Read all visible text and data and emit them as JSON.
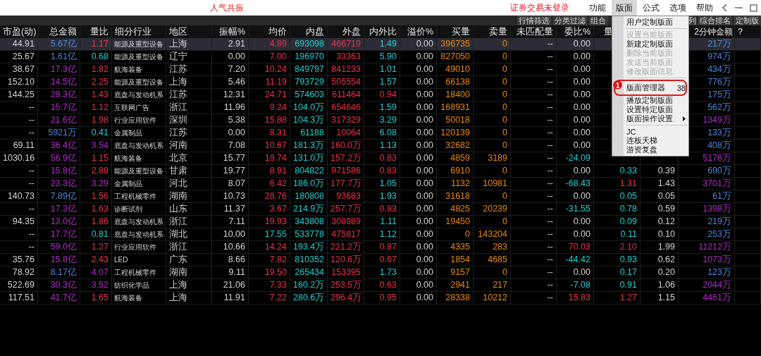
{
  "window": {
    "title": "人气共振",
    "login_status": "证券交易未登录"
  },
  "menus": [
    {
      "label": "功能",
      "selected": false
    },
    {
      "label": "版面",
      "selected": true
    },
    {
      "label": "公式",
      "selected": false
    },
    {
      "label": "选项",
      "selected": false
    },
    {
      "label": "帮助",
      "selected": false
    }
  ],
  "toolbar": [
    {
      "label": "行情筛选"
    },
    {
      "label": "分类过滤"
    },
    {
      "label": "组合"
    },
    {
      "label": "列"
    },
    {
      "label": "综合排名"
    },
    {
      "label": "定制版"
    }
  ],
  "table": {
    "columns": [
      {
        "label": "市盈(动)"
      },
      {
        "label": "总金额"
      },
      {
        "label": "量比"
      },
      {
        "label": "细分行业"
      },
      {
        "label": "地区"
      },
      {
        "label": "振幅%"
      },
      {
        "label": "均价"
      },
      {
        "label": "内盘"
      },
      {
        "label": "外盘"
      },
      {
        "label": "内外比"
      },
      {
        "label": "溢价%"
      },
      {
        "label": "买量"
      },
      {
        "label": "卖量"
      },
      {
        "label": "未匹配量"
      },
      {
        "label": "委比%"
      },
      {
        "label": "量"
      },
      null,
      {
        "label": "2分钟金额"
      },
      {
        "label": "?"
      }
    ],
    "rows": [
      {
        "selected": true,
        "cells": [
          {
            "text": "44.91",
            "kind": "plain"
          },
          {
            "text": "5.67亿",
            "kind": "tier1"
          },
          {
            "text": "1.17",
            "kind": "up"
          },
          {
            "text": "能源及重型设备",
            "kind": "plain"
          },
          {
            "text": "上海",
            "kind": "plain"
          },
          {
            "text": "2.91",
            "kind": "plain"
          },
          {
            "text": "4.89",
            "kind": "up"
          },
          {
            "text": "693098",
            "kind": "down"
          },
          {
            "text": "466719",
            "kind": "up"
          },
          {
            "text": "1.49",
            "kind": "down"
          },
          {
            "text": "0.00",
            "kind": "plain"
          },
          {
            "text": "396735",
            "kind": "volume"
          },
          {
            "text": "0",
            "kind": "volume"
          },
          {
            "text": "--",
            "kind": "plain"
          },
          {
            "text": "0.00",
            "kind": "plain"
          },
          null,
          null,
          {
            "text": "217万",
            "kind": "tier1"
          }
        ]
      },
      {
        "selected": false,
        "cells": [
          {
            "text": "25.67",
            "kind": "plain"
          },
          {
            "text": "1.61亿",
            "kind": "tier1"
          },
          {
            "text": "0.68",
            "kind": "down"
          },
          {
            "text": "能源及重型设备",
            "kind": "plain"
          },
          {
            "text": "辽宁",
            "kind": "plain"
          },
          {
            "text": "0.00",
            "kind": "plain"
          },
          {
            "text": "7.00",
            "kind": "up"
          },
          {
            "text": "196970",
            "kind": "down"
          },
          {
            "text": "33363",
            "kind": "up"
          },
          {
            "text": "5.90",
            "kind": "down"
          },
          {
            "text": "0.00",
            "kind": "plain"
          },
          {
            "text": "827050",
            "kind": "volume"
          },
          {
            "text": "0",
            "kind": "volume"
          },
          {
            "text": "--",
            "kind": "plain"
          },
          {
            "text": "0.00",
            "kind": "plain"
          },
          null,
          null,
          {
            "text": "974万",
            "kind": "tier1"
          }
        ]
      },
      {
        "selected": false,
        "cells": [
          {
            "text": "38.67",
            "kind": "plain"
          },
          {
            "text": "17.3亿",
            "kind": "tier2"
          },
          {
            "text": "1.82",
            "kind": "up"
          },
          {
            "text": "航海装备",
            "kind": "plain"
          },
          {
            "text": "江苏",
            "kind": "plain"
          },
          {
            "text": "7.20",
            "kind": "plain"
          },
          {
            "text": "10.24",
            "kind": "up"
          },
          {
            "text": "849797",
            "kind": "down"
          },
          {
            "text": "841233",
            "kind": "up"
          },
          {
            "text": "1.01",
            "kind": "down"
          },
          {
            "text": "0.00",
            "kind": "plain"
          },
          {
            "text": "49010",
            "kind": "volume"
          },
          {
            "text": "0",
            "kind": "volume"
          },
          {
            "text": "--",
            "kind": "plain"
          },
          {
            "text": "0.00",
            "kind": "plain"
          },
          null,
          null,
          {
            "text": "434万",
            "kind": "tier1"
          }
        ]
      },
      {
        "selected": false,
        "cells": [
          {
            "text": "152.10",
            "kind": "plain"
          },
          {
            "text": "14.5亿",
            "kind": "tier2"
          },
          {
            "text": "2.25",
            "kind": "up"
          },
          {
            "text": "能源及重型设备",
            "kind": "plain"
          },
          {
            "text": "上海",
            "kind": "plain"
          },
          {
            "text": "5.46",
            "kind": "plain"
          },
          {
            "text": "11.19",
            "kind": "up"
          },
          {
            "text": "793729",
            "kind": "down"
          },
          {
            "text": "505554",
            "kind": "up"
          },
          {
            "text": "1.57",
            "kind": "down"
          },
          {
            "text": "0.00",
            "kind": "plain"
          },
          {
            "text": "66138",
            "kind": "volume"
          },
          {
            "text": "0",
            "kind": "volume"
          },
          {
            "text": "--",
            "kind": "plain"
          },
          {
            "text": "0.00",
            "kind": "plain"
          },
          null,
          null,
          {
            "text": "776万",
            "kind": "tier1"
          }
        ]
      },
      {
        "selected": false,
        "cells": [
          {
            "text": "144.25",
            "kind": "plain"
          },
          {
            "text": "29.3亿",
            "kind": "tier2"
          },
          {
            "text": "1.43",
            "kind": "up"
          },
          {
            "text": "底盘与发动机系",
            "kind": "plain"
          },
          {
            "text": "江苏",
            "kind": "plain"
          },
          {
            "text": "12.31",
            "kind": "plain"
          },
          {
            "text": "24.71",
            "kind": "up"
          },
          {
            "text": "574603",
            "kind": "down"
          },
          {
            "text": "611464",
            "kind": "up"
          },
          {
            "text": "0.94",
            "kind": "up"
          },
          {
            "text": "0.00",
            "kind": "plain"
          },
          {
            "text": "18400",
            "kind": "volume"
          },
          {
            "text": "0",
            "kind": "volume"
          },
          {
            "text": "--",
            "kind": "plain"
          },
          {
            "text": "0.00",
            "kind": "plain"
          },
          null,
          null,
          {
            "text": "175万",
            "kind": "tier1"
          }
        ]
      },
      {
        "selected": false,
        "cells": [
          {
            "text": "--",
            "kind": "plain"
          },
          {
            "text": "15.7亿",
            "kind": "tier2"
          },
          {
            "text": "1.12",
            "kind": "up"
          },
          {
            "text": "互联网广告",
            "kind": "plain"
          },
          {
            "text": "浙江",
            "kind": "plain"
          },
          {
            "text": "11.96",
            "kind": "plain"
          },
          {
            "text": "9.24",
            "kind": "up"
          },
          {
            "text": "104.0万",
            "kind": "down"
          },
          {
            "text": "654646",
            "kind": "up"
          },
          {
            "text": "1.59",
            "kind": "down"
          },
          {
            "text": "0.00",
            "kind": "plain"
          },
          {
            "text": "168931",
            "kind": "volume"
          },
          {
            "text": "0",
            "kind": "volume"
          },
          {
            "text": "--",
            "kind": "plain"
          },
          {
            "text": "0.00",
            "kind": "plain"
          },
          null,
          null,
          {
            "text": "562万",
            "kind": "tier1"
          }
        ]
      },
      {
        "selected": false,
        "cells": [
          {
            "text": "--",
            "kind": "plain"
          },
          {
            "text": "21.6亿",
            "kind": "tier2"
          },
          {
            "text": "1.98",
            "kind": "up"
          },
          {
            "text": "行业应用软件",
            "kind": "plain"
          },
          {
            "text": "深圳",
            "kind": "plain"
          },
          {
            "text": "5.38",
            "kind": "plain"
          },
          {
            "text": "15.88",
            "kind": "up"
          },
          {
            "text": "104.3万",
            "kind": "down"
          },
          {
            "text": "317329",
            "kind": "up"
          },
          {
            "text": "3.29",
            "kind": "down"
          },
          {
            "text": "0.00",
            "kind": "plain"
          },
          {
            "text": "50018",
            "kind": "volume"
          },
          {
            "text": "0",
            "kind": "volume"
          },
          {
            "text": "--",
            "kind": "plain"
          },
          {
            "text": "0.00",
            "kind": "plain"
          },
          null,
          null,
          {
            "text": "1349万",
            "kind": "tier2"
          }
        ]
      },
      {
        "selected": false,
        "cells": [
          {
            "text": "--",
            "kind": "plain"
          },
          {
            "text": "5921万",
            "kind": "tier1"
          },
          {
            "text": "0.41",
            "kind": "down"
          },
          {
            "text": "金属制品",
            "kind": "plain"
          },
          {
            "text": "江苏",
            "kind": "plain"
          },
          {
            "text": "0.00",
            "kind": "plain"
          },
          {
            "text": "8.31",
            "kind": "up"
          },
          {
            "text": "61188",
            "kind": "down"
          },
          {
            "text": "10064",
            "kind": "up"
          },
          {
            "text": "6.08",
            "kind": "down"
          },
          {
            "text": "0.00",
            "kind": "plain"
          },
          {
            "text": "120139",
            "kind": "volume"
          },
          {
            "text": "0",
            "kind": "volume"
          },
          {
            "text": "--",
            "kind": "plain"
          },
          {
            "text": "0.00",
            "kind": "plain"
          },
          null,
          null,
          {
            "text": "133万",
            "kind": "tier1"
          }
        ]
      },
      {
        "selected": false,
        "cells": [
          {
            "text": "69.11",
            "kind": "plain"
          },
          {
            "text": "36.4亿",
            "kind": "tier2"
          },
          {
            "text": "3.54",
            "kind": "tier2"
          },
          {
            "text": "底盘与发动机系",
            "kind": "plain"
          },
          {
            "text": "河南",
            "kind": "plain"
          },
          {
            "text": "7.08",
            "kind": "plain"
          },
          {
            "text": "10.67",
            "kind": "up"
          },
          {
            "text": "181.3万",
            "kind": "down"
          },
          {
            "text": "160.0万",
            "kind": "up"
          },
          {
            "text": "1.13",
            "kind": "down"
          },
          {
            "text": "0.00",
            "kind": "plain"
          },
          {
            "text": "32682",
            "kind": "volume"
          },
          {
            "text": "0",
            "kind": "volume"
          },
          {
            "text": "--",
            "kind": "plain"
          },
          {
            "text": "0.00",
            "kind": "plain"
          },
          null,
          null,
          {
            "text": "408万",
            "kind": "tier1"
          }
        ]
      },
      {
        "selected": false,
        "cells": [
          {
            "text": "1030.16",
            "kind": "plain"
          },
          {
            "text": "56.9亿",
            "kind": "tier2"
          },
          {
            "text": "1.15",
            "kind": "up"
          },
          {
            "text": "航海装备",
            "kind": "plain"
          },
          {
            "text": "北京",
            "kind": "plain"
          },
          {
            "text": "15.77",
            "kind": "plain"
          },
          {
            "text": "19.74",
            "kind": "up"
          },
          {
            "text": "131.0万",
            "kind": "down"
          },
          {
            "text": "157.2万",
            "kind": "up"
          },
          {
            "text": "0.83",
            "kind": "up"
          },
          {
            "text": "0.00",
            "kind": "plain"
          },
          {
            "text": "4859",
            "kind": "volume"
          },
          {
            "text": "3189",
            "kind": "volume"
          },
          {
            "text": "--",
            "kind": "plain"
          },
          {
            "text": "-24.09",
            "kind": "down"
          },
          null,
          null,
          {
            "text": "5176万",
            "kind": "tier2"
          }
        ]
      },
      {
        "selected": false,
        "cells": [
          {
            "text": "--",
            "kind": "plain"
          },
          {
            "text": "15.8亿",
            "kind": "tier2"
          },
          {
            "text": "2.88",
            "kind": "up"
          },
          {
            "text": "能源及重型设备",
            "kind": "plain"
          },
          {
            "text": "甘肃",
            "kind": "plain"
          },
          {
            "text": "19.77",
            "kind": "plain"
          },
          {
            "text": "8.91",
            "kind": "up"
          },
          {
            "text": "804822",
            "kind": "down"
          },
          {
            "text": "971586",
            "kind": "up"
          },
          {
            "text": "0.83",
            "kind": "up"
          },
          {
            "text": "0.00",
            "kind": "plain"
          },
          {
            "text": "6910",
            "kind": "volume"
          },
          {
            "text": "0",
            "kind": "volume"
          },
          {
            "text": "--",
            "kind": "plain"
          },
          {
            "text": "0.00",
            "kind": "plain"
          },
          {
            "text": "0.33",
            "kind": "down"
          },
          {
            "text": "0.39",
            "kind": "plain"
          },
          {
            "text": "690万",
            "kind": "tier1"
          }
        ]
      },
      {
        "selected": false,
        "cells": [
          {
            "text": "--",
            "kind": "plain"
          },
          {
            "text": "23.3亿",
            "kind": "tier2"
          },
          {
            "text": "3.29",
            "kind": "tier2"
          },
          {
            "text": "金属制品",
            "kind": "plain"
          },
          {
            "text": "河北",
            "kind": "plain"
          },
          {
            "text": "8.07",
            "kind": "plain"
          },
          {
            "text": "6.42",
            "kind": "up"
          },
          {
            "text": "186.0万",
            "kind": "down"
          },
          {
            "text": "177.7万",
            "kind": "up"
          },
          {
            "text": "1.05",
            "kind": "down"
          },
          {
            "text": "0.00",
            "kind": "plain"
          },
          {
            "text": "1132",
            "kind": "volume"
          },
          {
            "text": "10981",
            "kind": "volume"
          },
          {
            "text": "--",
            "kind": "plain"
          },
          {
            "text": "-68.43",
            "kind": "down"
          },
          {
            "text": "1.31",
            "kind": "up"
          },
          {
            "text": "1.43",
            "kind": "plain"
          },
          {
            "text": "3701万",
            "kind": "tier2"
          }
        ]
      },
      {
        "selected": false,
        "cells": [
          {
            "text": "140.73",
            "kind": "plain"
          },
          {
            "text": "7.89亿",
            "kind": "tier1"
          },
          {
            "text": "1.56",
            "kind": "up"
          },
          {
            "text": "工程机械零件",
            "kind": "plain"
          },
          {
            "text": "湖南",
            "kind": "plain"
          },
          {
            "text": "10.73",
            "kind": "plain"
          },
          {
            "text": "28.76",
            "kind": "up"
          },
          {
            "text": "180808",
            "kind": "down"
          },
          {
            "text": "93683",
            "kind": "up"
          },
          {
            "text": "1.93",
            "kind": "down"
          },
          {
            "text": "0.00",
            "kind": "plain"
          },
          {
            "text": "31618",
            "kind": "volume"
          },
          {
            "text": "0",
            "kind": "volume"
          },
          {
            "text": "--",
            "kind": "plain"
          },
          {
            "text": "0.00",
            "kind": "plain"
          },
          {
            "text": "0.05",
            "kind": "down"
          },
          {
            "text": "0.05",
            "kind": "plain"
          },
          {
            "text": "61万",
            "kind": "tier1"
          }
        ]
      },
      {
        "selected": false,
        "cells": [
          {
            "text": "--",
            "kind": "plain"
          },
          {
            "text": "17.3亿",
            "kind": "tier2"
          },
          {
            "text": "1.63",
            "kind": "up"
          },
          {
            "text": "诊断试剂",
            "kind": "plain"
          },
          {
            "text": "山东",
            "kind": "plain"
          },
          {
            "text": "11.37",
            "kind": "plain"
          },
          {
            "text": "3.67",
            "kind": "up"
          },
          {
            "text": "214.9万",
            "kind": "down"
          },
          {
            "text": "257.7万",
            "kind": "up"
          },
          {
            "text": "0.83",
            "kind": "up"
          },
          {
            "text": "0.00",
            "kind": "plain"
          },
          {
            "text": "4825",
            "kind": "volume"
          },
          {
            "text": "20239",
            "kind": "volume"
          },
          {
            "text": "--",
            "kind": "plain"
          },
          {
            "text": "-31.55",
            "kind": "down"
          },
          {
            "text": "0.78",
            "kind": "down"
          },
          {
            "text": "0.59",
            "kind": "plain"
          },
          {
            "text": "1398万",
            "kind": "tier2"
          }
        ]
      },
      {
        "selected": false,
        "cells": [
          {
            "text": "94.35",
            "kind": "plain"
          },
          {
            "text": "13.0亿",
            "kind": "tier2"
          },
          {
            "text": "1.86",
            "kind": "up"
          },
          {
            "text": "底盘与发动机系",
            "kind": "plain"
          },
          {
            "text": "浙江",
            "kind": "plain"
          },
          {
            "text": "7.11",
            "kind": "plain"
          },
          {
            "text": "19.93",
            "kind": "up"
          },
          {
            "text": "343808",
            "kind": "down"
          },
          {
            "text": "308989",
            "kind": "up"
          },
          {
            "text": "1.11",
            "kind": "down"
          },
          {
            "text": "0.00",
            "kind": "plain"
          },
          {
            "text": "19450",
            "kind": "volume"
          },
          {
            "text": "0",
            "kind": "volume"
          },
          {
            "text": "--",
            "kind": "plain"
          },
          {
            "text": "0.00",
            "kind": "plain"
          },
          {
            "text": "0.09",
            "kind": "down"
          },
          {
            "text": "0.12",
            "kind": "plain"
          },
          {
            "text": "219万",
            "kind": "tier1"
          }
        ]
      },
      {
        "selected": false,
        "cells": [
          {
            "text": "--",
            "kind": "plain"
          },
          {
            "text": "17.7亿",
            "kind": "tier2"
          },
          {
            "text": "0.81",
            "kind": "down"
          },
          {
            "text": "底盘与发动机系",
            "kind": "plain"
          },
          {
            "text": "湖北",
            "kind": "plain"
          },
          {
            "text": "10.00",
            "kind": "plain"
          },
          {
            "text": "17.55",
            "kind": "down"
          },
          {
            "text": "533778",
            "kind": "down"
          },
          {
            "text": "475817",
            "kind": "up"
          },
          {
            "text": "1.12",
            "kind": "down"
          },
          {
            "text": "0.00",
            "kind": "plain"
          },
          {
            "text": "0",
            "kind": "volume"
          },
          {
            "text": "143204",
            "kind": "volume"
          },
          {
            "text": "--",
            "kind": "plain"
          },
          {
            "text": "0.00",
            "kind": "plain"
          },
          {
            "text": "0.11",
            "kind": "down"
          },
          {
            "text": "0.10",
            "kind": "plain"
          },
          {
            "text": "253万",
            "kind": "tier1"
          }
        ]
      },
      {
        "selected": false,
        "cells": [
          {
            "text": "--",
            "kind": "plain"
          },
          {
            "text": "59.0亿",
            "kind": "tier2"
          },
          {
            "text": "1.27",
            "kind": "up"
          },
          {
            "text": "行业应用软件",
            "kind": "plain"
          },
          {
            "text": "浙江",
            "kind": "plain"
          },
          {
            "text": "10.66",
            "kind": "plain"
          },
          {
            "text": "14.24",
            "kind": "up"
          },
          {
            "text": "193.4万",
            "kind": "down"
          },
          {
            "text": "221.2万",
            "kind": "up"
          },
          {
            "text": "0.87",
            "kind": "up"
          },
          {
            "text": "0.00",
            "kind": "plain"
          },
          {
            "text": "4335",
            "kind": "volume"
          },
          {
            "text": "283",
            "kind": "volume"
          },
          {
            "text": "--",
            "kind": "plain"
          },
          {
            "text": "70.03",
            "kind": "up"
          },
          {
            "text": "2.10",
            "kind": "up"
          },
          {
            "text": "1.99",
            "kind": "plain"
          },
          {
            "text": "11212万",
            "kind": "tier2"
          }
        ]
      },
      {
        "selected": false,
        "cells": [
          {
            "text": "35.76",
            "kind": "plain"
          },
          {
            "text": "15.8亿",
            "kind": "tier2"
          },
          {
            "text": "2.43",
            "kind": "up"
          },
          {
            "text": "LED",
            "kind": "plain"
          },
          {
            "text": "广东",
            "kind": "plain"
          },
          {
            "text": "8.66",
            "kind": "plain"
          },
          {
            "text": "7.82",
            "kind": "up"
          },
          {
            "text": "810352",
            "kind": "down"
          },
          {
            "text": "120.6万",
            "kind": "up"
          },
          {
            "text": "0.67",
            "kind": "up"
          },
          {
            "text": "0.00",
            "kind": "plain"
          },
          {
            "text": "1854",
            "kind": "volume"
          },
          {
            "text": "4685",
            "kind": "volume"
          },
          {
            "text": "--",
            "kind": "plain"
          },
          {
            "text": "-44.42",
            "kind": "down"
          },
          {
            "text": "0.93",
            "kind": "down"
          },
          {
            "text": "0.62",
            "kind": "plain"
          },
          {
            "text": "1073万",
            "kind": "tier2"
          }
        ]
      },
      {
        "selected": false,
        "cells": [
          {
            "text": "78.92",
            "kind": "plain"
          },
          {
            "text": "8.17亿",
            "kind": "tier1"
          },
          {
            "text": "4.07",
            "kind": "tier2"
          },
          {
            "text": "工程机械零件",
            "kind": "plain"
          },
          {
            "text": "湖南",
            "kind": "plain"
          },
          {
            "text": "9.11",
            "kind": "plain"
          },
          {
            "text": "19.50",
            "kind": "up"
          },
          {
            "text": "265434",
            "kind": "down"
          },
          {
            "text": "153395",
            "kind": "up"
          },
          {
            "text": "1.73",
            "kind": "down"
          },
          {
            "text": "0.00",
            "kind": "plain"
          },
          {
            "text": "9157",
            "kind": "volume"
          },
          {
            "text": "0",
            "kind": "volume"
          },
          {
            "text": "--",
            "kind": "plain"
          },
          {
            "text": "0.00",
            "kind": "plain"
          },
          {
            "text": "0.17",
            "kind": "down"
          },
          {
            "text": "0.20",
            "kind": "plain"
          },
          {
            "text": "123万",
            "kind": "tier1"
          }
        ]
      },
      {
        "selected": false,
        "cells": [
          {
            "text": "522.69",
            "kind": "plain"
          },
          {
            "text": "30.3亿",
            "kind": "tier2"
          },
          {
            "text": "3.52",
            "kind": "tier2"
          },
          {
            "text": "纺织化学品",
            "kind": "plain"
          },
          {
            "text": "上海",
            "kind": "plain"
          },
          {
            "text": "21.06",
            "kind": "plain"
          },
          {
            "text": "7.33",
            "kind": "up"
          },
          {
            "text": "160.2万",
            "kind": "down"
          },
          {
            "text": "253.5万",
            "kind": "up"
          },
          {
            "text": "0.63",
            "kind": "up"
          },
          {
            "text": "0.00",
            "kind": "plain"
          },
          {
            "text": "2941",
            "kind": "volume"
          },
          {
            "text": "217",
            "kind": "volume"
          },
          {
            "text": "--",
            "kind": "plain"
          },
          {
            "text": "-7.08",
            "kind": "down"
          },
          {
            "text": "0.91",
            "kind": "down"
          },
          {
            "text": "1.06",
            "kind": "plain"
          },
          {
            "text": "2044万",
            "kind": "tier2"
          }
        ]
      },
      {
        "selected": false,
        "cells": [
          {
            "text": "117.51",
            "kind": "plain"
          },
          {
            "text": "41.7亿",
            "kind": "tier2"
          },
          {
            "text": "1.65",
            "kind": "up"
          },
          {
            "text": "航海装备",
            "kind": "plain"
          },
          {
            "text": "上海",
            "kind": "plain"
          },
          {
            "text": "11.91",
            "kind": "plain"
          },
          {
            "text": "7.22",
            "kind": "up"
          },
          {
            "text": "280.6万",
            "kind": "down"
          },
          {
            "text": "296.4万",
            "kind": "up"
          },
          {
            "text": "0.95",
            "kind": "up"
          },
          {
            "text": "0.00",
            "kind": "plain"
          },
          {
            "text": "28338",
            "kind": "volume"
          },
          {
            "text": "10212",
            "kind": "volume"
          },
          {
            "text": "--",
            "kind": "plain"
          },
          {
            "text": "15.83",
            "kind": "up"
          },
          {
            "text": "1.27",
            "kind": "up"
          },
          {
            "text": "1.15",
            "kind": "plain"
          },
          {
            "text": "4461万",
            "kind": "tier2"
          }
        ]
      }
    ]
  },
  "menu": {
    "items": [
      {
        "kind": "item",
        "label": "用户定制版面",
        "disabled": false
      },
      {
        "kind": "separator"
      },
      {
        "kind": "item",
        "label": "设置当前版面",
        "disabled": true
      },
      {
        "kind": "item",
        "label": "新建定制版面",
        "disabled": false
      },
      {
        "kind": "item",
        "label": "删除当前版面",
        "disabled": true
      },
      {
        "kind": "item",
        "label": "发送当前版面",
        "disabled": true
      },
      {
        "kind": "item",
        "label": "修改版面信息",
        "disabled": true
      },
      {
        "kind": "separator"
      },
      {
        "kind": "item",
        "label": "版面管理器",
        "shortcut": "38",
        "disabled": false,
        "annotation": {
          "label": "1"
        }
      },
      {
        "kind": "item",
        "label": "播放定制版面",
        "disabled": false
      },
      {
        "kind": "item",
        "label": "设置特定版面",
        "disabled": false
      },
      {
        "kind": "item",
        "label": "版面操作设置",
        "submenu": true,
        "disabled": false
      },
      {
        "kind": "separator"
      },
      {
        "kind": "item",
        "label": "JC",
        "disabled": false
      },
      {
        "kind": "item",
        "label": "连板天梯",
        "disabled": false
      },
      {
        "kind": "item",
        "label": "游资复盘",
        "disabled": false
      }
    ]
  }
}
